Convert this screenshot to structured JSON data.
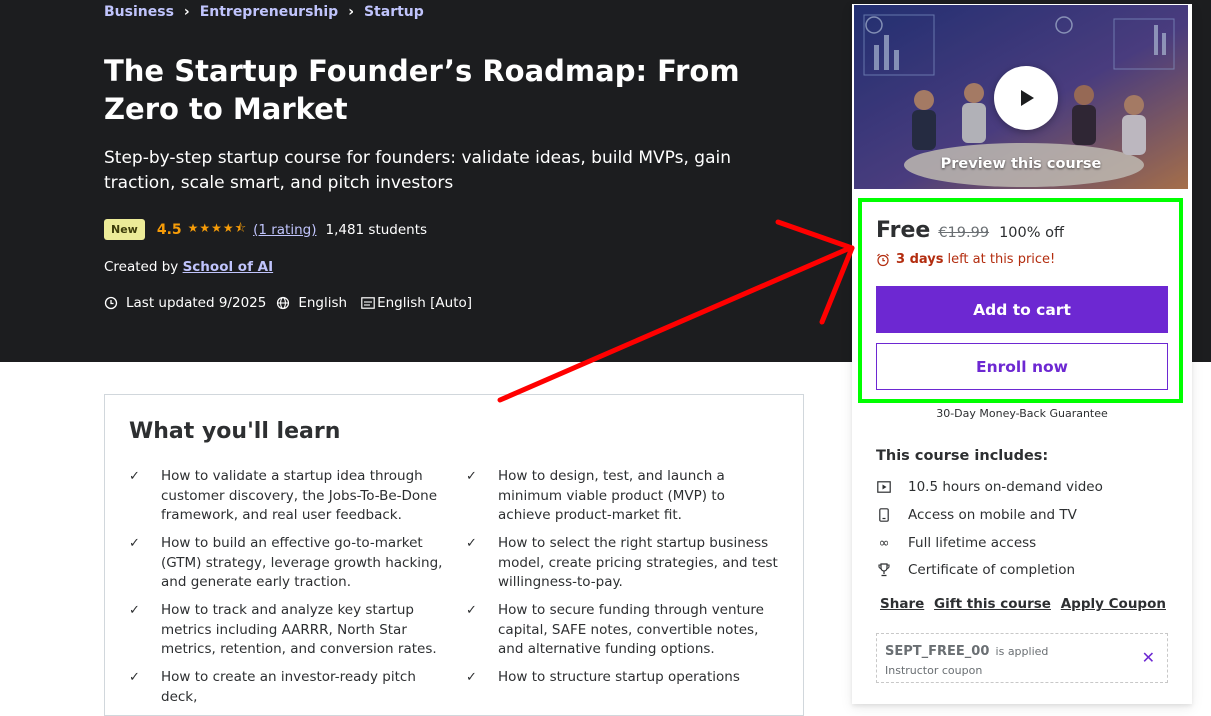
{
  "breadcrumb": [
    "Business",
    "Entrepreneurship",
    "Startup"
  ],
  "course": {
    "title": "The Startup Founder’s Roadmap: From Zero to Market",
    "subtitle": "Step-by-step startup course for founders: validate ideas, build MVPs, gain traction, scale smart, and pitch investors",
    "badge": "New",
    "rating": "4.5",
    "rating_count": "(1 rating)",
    "students": "1,481 students",
    "created_by_label": "Created by",
    "instructor": "School of AI",
    "last_updated": "Last updated 9/2025",
    "language": "English",
    "captions": "English [Auto]"
  },
  "learn": {
    "heading": "What you'll learn",
    "items": [
      "How to validate a startup idea through customer discovery, the Jobs-To-Be-Done framework, and real user feedback.",
      "How to design, test, and launch a minimum viable product (MVP) to achieve product-market fit.",
      "How to build an effective go-to-market (GTM) strategy, leverage growth hacking, and generate early traction.",
      "How to select the right startup business model, create pricing strategies, and test willingness-to-pay.",
      "How to track and analyze key startup metrics including AARRR, North Star metrics, retention, and conversion rates.",
      "How to secure funding through venture capital, SAFE notes, convertible notes, and alternative funding options.",
      "How to create an investor-ready pitch deck,",
      "How to structure startup operations"
    ]
  },
  "sidebar": {
    "preview_label": "Preview this course",
    "price": "Free",
    "old_price": "€19.99",
    "discount": "100% off",
    "timer_bold": "3 days",
    "timer_rest": "left at this price!",
    "add_to_cart": "Add to cart",
    "enroll_now": "Enroll now",
    "guarantee": "30-Day Money-Back Guarantee",
    "includes_title": "This course includes:",
    "includes": [
      {
        "icon": "video-icon",
        "text": "10.5 hours on-demand video"
      },
      {
        "icon": "mobile-icon",
        "text": "Access on mobile and TV"
      },
      {
        "icon": "infinity-icon",
        "text": "Full lifetime access"
      },
      {
        "icon": "trophy-icon",
        "text": "Certificate of completion"
      }
    ],
    "links": [
      "Share",
      "Gift this course",
      "Apply Coupon"
    ],
    "coupon_code": "SEPT_FREE_00",
    "coupon_applied": "is applied",
    "coupon_type": "Instructor coupon"
  },
  "colors": {
    "hero_bg": "#1c1d1f",
    "accent": "#6d28d2",
    "link_purple": "#c0c4fc",
    "star": "#f69c08",
    "annotation_red": "#ff0000",
    "annotation_green": "#00ff00"
  }
}
